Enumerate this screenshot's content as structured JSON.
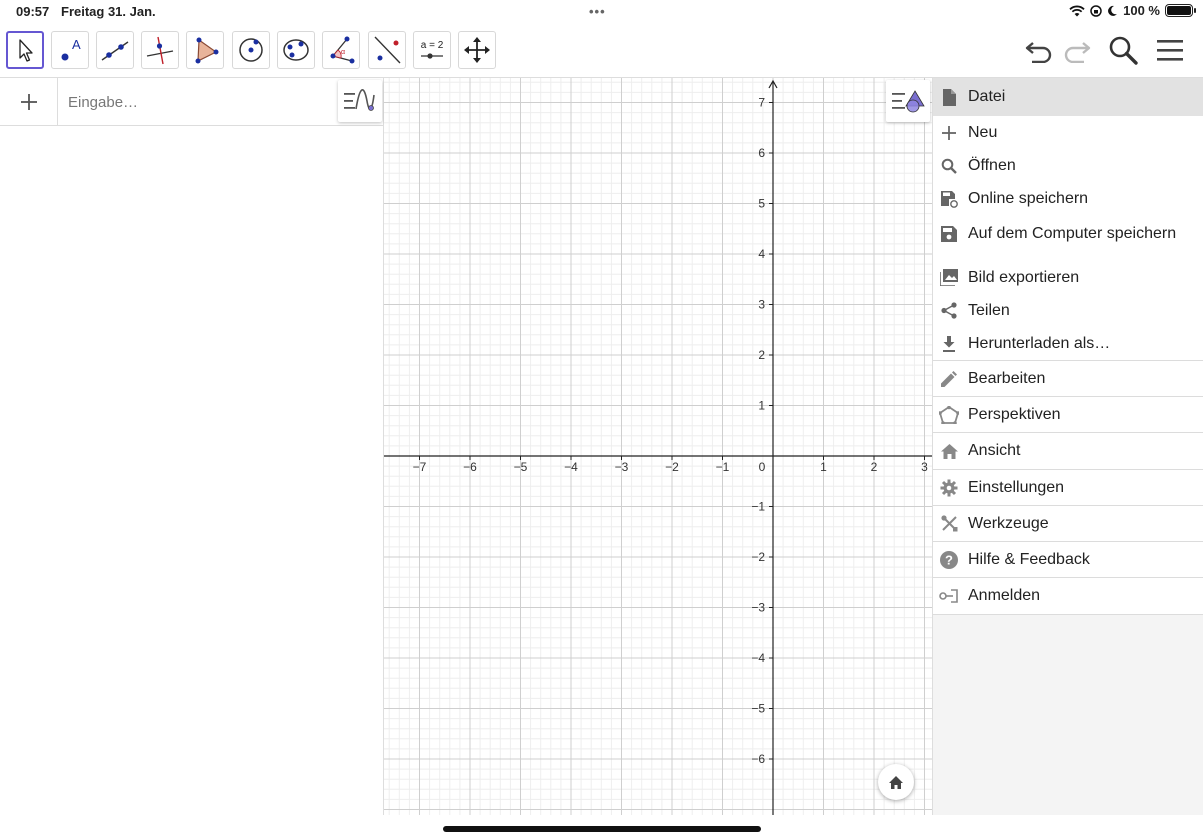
{
  "status_bar": {
    "time": "09:57",
    "date": "Freitag 31. Jan.",
    "battery": "100 %",
    "dots": "•••"
  },
  "toolbar": {
    "tools": [
      {
        "name": "move-tool",
        "icon": "pointer-arrow-icon",
        "active": true
      },
      {
        "name": "point-tool",
        "icon": "point-icon"
      },
      {
        "name": "line-tool",
        "icon": "line-through-points-icon"
      },
      {
        "name": "perpendicular-tool",
        "icon": "perpendicular-line-icon"
      },
      {
        "name": "polygon-tool",
        "icon": "polygon-icon"
      },
      {
        "name": "circle-tool",
        "icon": "circle-center-point-icon"
      },
      {
        "name": "conic-tool",
        "icon": "circle-through-three-points-icon"
      },
      {
        "name": "angle-tool",
        "icon": "angle-icon"
      },
      {
        "name": "reflect-tool",
        "icon": "reflect-about-line-icon"
      },
      {
        "name": "slider-tool",
        "icon": "slider-icon",
        "label": "a = 2"
      },
      {
        "name": "move-graphics-tool",
        "icon": "move-graphics-view-icon"
      }
    ],
    "right_icons": [
      "undo-icon",
      "redo-icon",
      "search-icon",
      "hamburger-menu-icon"
    ]
  },
  "algebra": {
    "input_placeholder": "Eingabe…",
    "add_icon": "plus-icon"
  },
  "graphics": {
    "x_ticks": [
      "−7",
      "−6",
      "−5",
      "−4",
      "−3",
      "−2",
      "−1",
      "0",
      "1",
      "2",
      "3"
    ],
    "y_ticks_pos": [
      "7",
      "6",
      "5",
      "4",
      "3",
      "2",
      "1"
    ],
    "y_ticks_neg": [
      "−1",
      "−2",
      "−3",
      "−4",
      "−5",
      "−6"
    ]
  },
  "menu": {
    "header": {
      "label": "Datei",
      "icon": "file-icon"
    },
    "file_items": [
      {
        "label": "Neu",
        "icon": "plus-icon"
      },
      {
        "label": "Öffnen",
        "icon": "search-icon"
      },
      {
        "label": "Online speichern",
        "icon": "save-online-icon"
      },
      {
        "label": "Auf dem Computer speichern",
        "icon": "save-icon"
      },
      {
        "label": "Bild exportieren",
        "icon": "image-export-icon"
      },
      {
        "label": "Teilen",
        "icon": "share-icon"
      },
      {
        "label": "Herunterladen als…",
        "icon": "download-icon"
      }
    ],
    "main_items": [
      {
        "label": "Bearbeiten",
        "icon": "pencil-icon"
      },
      {
        "label": "Perspektiven",
        "icon": "perspectives-icon"
      },
      {
        "label": "Ansicht",
        "icon": "home-icon"
      },
      {
        "label": "Einstellungen",
        "icon": "gear-icon"
      },
      {
        "label": "Werkzeuge",
        "icon": "tools-icon"
      },
      {
        "label": "Hilfe & Feedback",
        "icon": "help-icon"
      },
      {
        "label": "Anmelden",
        "icon": "sign-in-icon"
      }
    ]
  }
}
